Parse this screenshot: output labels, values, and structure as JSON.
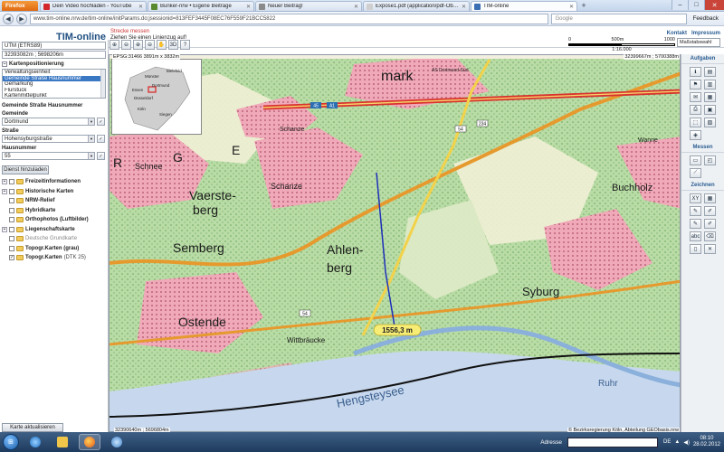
{
  "browser": {
    "menu_button": "Firefox",
    "tabs": [
      {
        "label": "Dein Video hochladen - YouTube",
        "color": "#d3262b",
        "active": false
      },
      {
        "label": "Bunker-nrw • Eigene Beiträge",
        "color": "#5a8a2e",
        "active": false
      },
      {
        "label": "Neuer Beitrag!",
        "color": "#8a8a8a",
        "active": false
      },
      {
        "label": "Expose1.pdf (application/pdf-Objekt)",
        "color": "#cfcfcf",
        "active": false
      },
      {
        "label": "TIM-online",
        "color": "#3a6fb3",
        "active": true
      }
    ],
    "url": "www.tim-online.nrw.de/tim-online/initParams.do;jsessionid=813FEF3445F08EC76F559F21BCC5822",
    "search_placeholder": "Google",
    "feedback": "Feedback"
  },
  "app": {
    "title": "TIM-online",
    "tool_title": "Strecke messen",
    "tool_hint": "Ziehen Sie einen Linienzug auf!",
    "links": {
      "kontakt": "Kontakt",
      "impressum": "Impressum"
    },
    "scale": {
      "ticks": [
        "0",
        "500m",
        "1000"
      ],
      "ratio": "1:16.000",
      "select_label": "Maßstabswahl"
    },
    "toolbar": [
      "⊕",
      "⊖",
      "⊕",
      "⊖",
      "✋",
      "3D",
      "?"
    ]
  },
  "left": {
    "crs": "UTM (ETRS89)",
    "coords": "32393082m ; 5698206m",
    "positioning_label": "Kartenpositionierung",
    "positioning_options": [
      "Verwaltungseinheit",
      "Gemeinde Straße Hausnummer",
      "Gemarkung",
      "Flurstück",
      "Kartenmittelpunkt"
    ],
    "selected_option": 1,
    "form_title": "Gemeinde Straße Hausnummer",
    "gemeinde_label": "Gemeinde",
    "gemeinde_value": "Dortmund",
    "strasse_label": "Straße",
    "strasse_value": "Hohensyburgstraße",
    "hausnummer_label": "Hausnummer",
    "hausnummer_value": "55",
    "dienst_button": "Dienst hinzuladen",
    "layers": [
      {
        "name": "Freizeitinformationen",
        "expand": "+",
        "checked": false,
        "grey": false,
        "extra": ""
      },
      {
        "name": "Historische Karten",
        "expand": "+",
        "checked": false,
        "grey": false,
        "extra": ""
      },
      {
        "name": "NRW-Relief",
        "expand": "",
        "checked": false,
        "grey": false,
        "extra": ""
      },
      {
        "name": "Hybridkarte",
        "expand": "",
        "checked": false,
        "grey": false,
        "extra": ""
      },
      {
        "name": "Orthophotos (Luftbilder)",
        "expand": "",
        "checked": false,
        "grey": false,
        "extra": ""
      },
      {
        "name": "Liegenschaftskarte",
        "expand": "+",
        "checked": false,
        "grey": false,
        "extra": ""
      },
      {
        "name": "Deutsche Grundkarte",
        "expand": "",
        "checked": false,
        "grey": true,
        "extra": ""
      },
      {
        "name": "Topogr.Karten (grau)",
        "expand": "",
        "checked": false,
        "grey": false,
        "extra": ""
      },
      {
        "name": "Topogr.Karten",
        "expand": "",
        "checked": true,
        "grey": false,
        "extra": "(DTK 25)"
      }
    ],
    "refresh_button": "Karte aktualisieren"
  },
  "map": {
    "coord_tl": "EPSG:31466   3891m x 3832m",
    "coord_tr": "32399667m ; 5700388m",
    "coord_bl": "32390640m ; 5696804m",
    "copyright": "© Bezirksregierung Köln, Abteilung GEObasis.nrw",
    "measure_label": "1556,3 m",
    "inset_labels": [
      "Bielefeld",
      "Münster",
      "Dortmund",
      "Essen",
      "Düsseldorf",
      "Köln",
      "Siegen"
    ],
    "labels": [
      "mark",
      "AS Dortmund-Süd",
      "Schnee",
      "G",
      "E",
      "R",
      "Schanze",
      "Schanze",
      "Vaerste-",
      "berg",
      "Semberg",
      "Ahlen-",
      "berg",
      "Buchholz",
      "Syburg",
      "Ostende",
      "Wittbräucke",
      "Hengsteysee",
      "Ruhr",
      "Wanne"
    ],
    "road_numbers": [
      "45",
      "A1",
      "54",
      "234",
      "54"
    ]
  },
  "right": {
    "aufgaben": "Aufgaben",
    "messen": "Messen",
    "zeichnen": "Zeichnen",
    "aufgaben_buttons": [
      "ℹ",
      "▤",
      "⚑",
      "▥",
      "✉",
      "▦",
      "⎙",
      "▣",
      "⬚",
      "▧",
      "◈"
    ],
    "messen_buttons": [
      "▭",
      "◰",
      "⟋"
    ],
    "zeichnen_buttons": [
      "XY",
      "▦",
      "✎",
      "✐",
      "✎",
      "✐",
      "abc",
      "⌫",
      "▯",
      "✕"
    ]
  },
  "taskbar": {
    "address_label": "Adresse",
    "lang": "DE",
    "time": "08:10",
    "date": "28.02.2012"
  }
}
